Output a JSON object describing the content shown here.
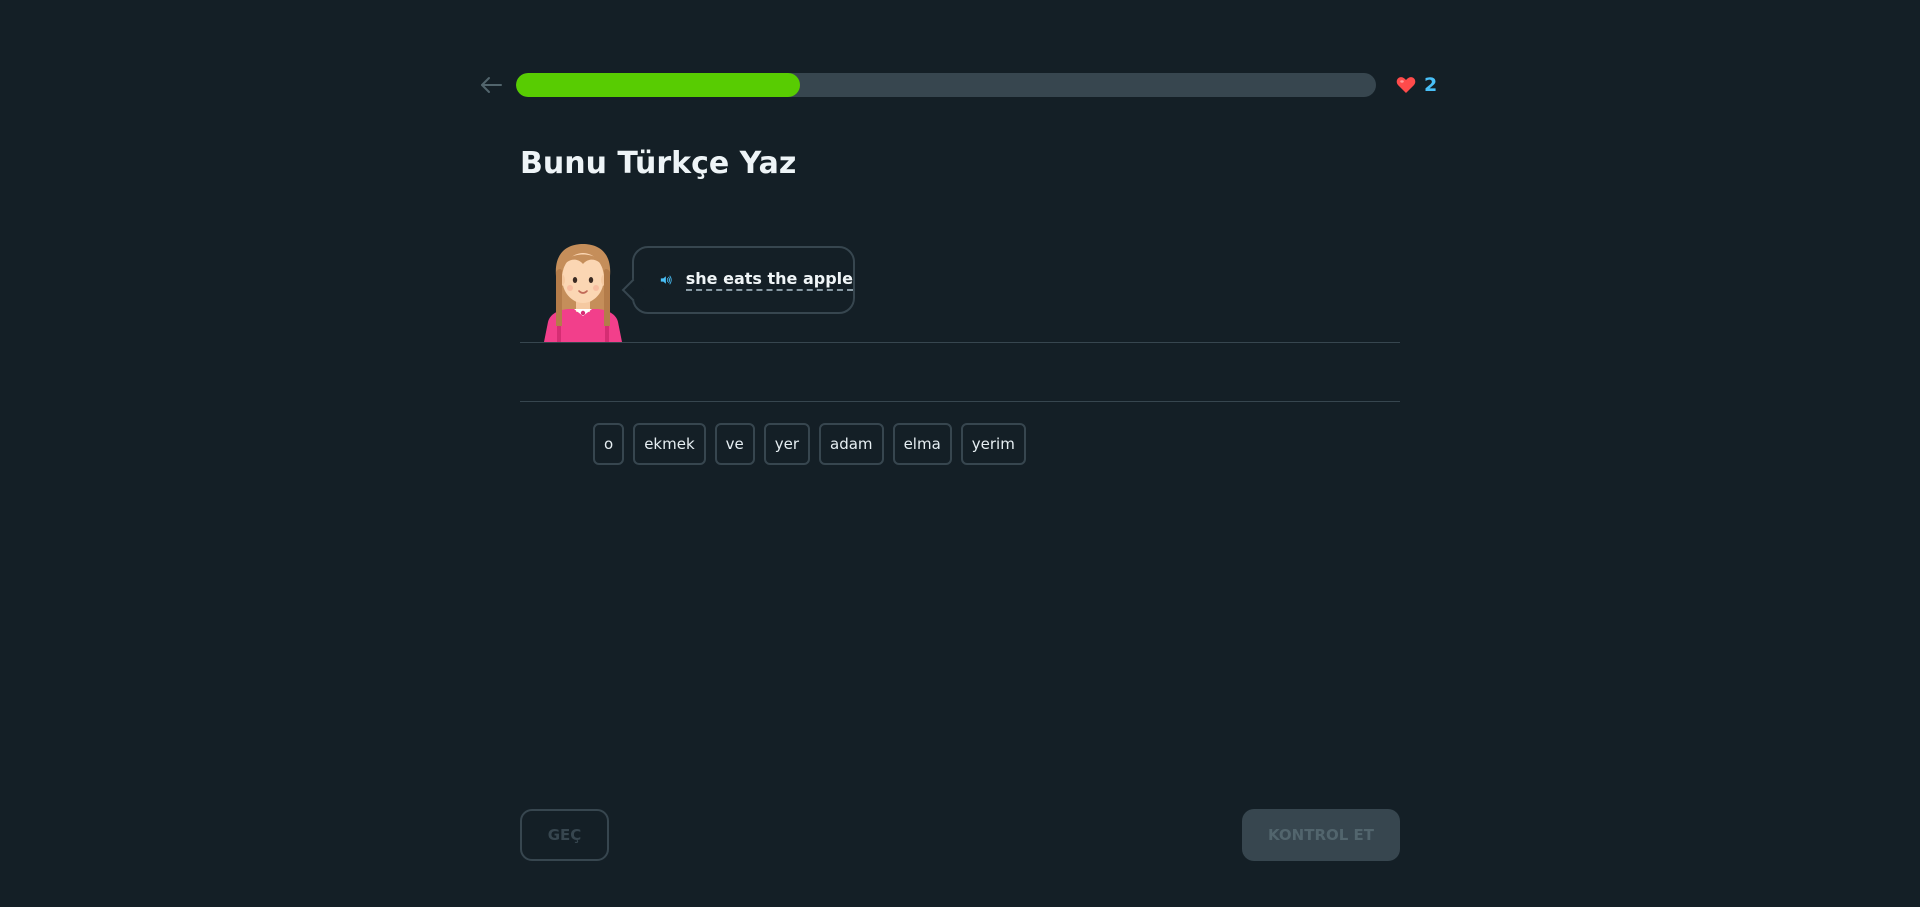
{
  "progress": {
    "value": 0.33,
    "fill_color": "#58cc02",
    "track_color": "#37464f"
  },
  "hearts": {
    "icon": "heart-icon",
    "count": "2",
    "color": "#ff4b4b"
  },
  "back": {
    "icon": "arrow-left-icon"
  },
  "title": "Bunu Türkçe Yaz",
  "prompt": {
    "speaker_icon": "speaker-icon",
    "character_icon": "girl-character-icon",
    "text": "she eats the apple"
  },
  "word_bank": [
    "o",
    "ekmek",
    "ve",
    "yer",
    "adam",
    "elma",
    "yerim"
  ],
  "footer": {
    "skip_label": "GEÇ",
    "check_label": "KONTROL ET"
  }
}
